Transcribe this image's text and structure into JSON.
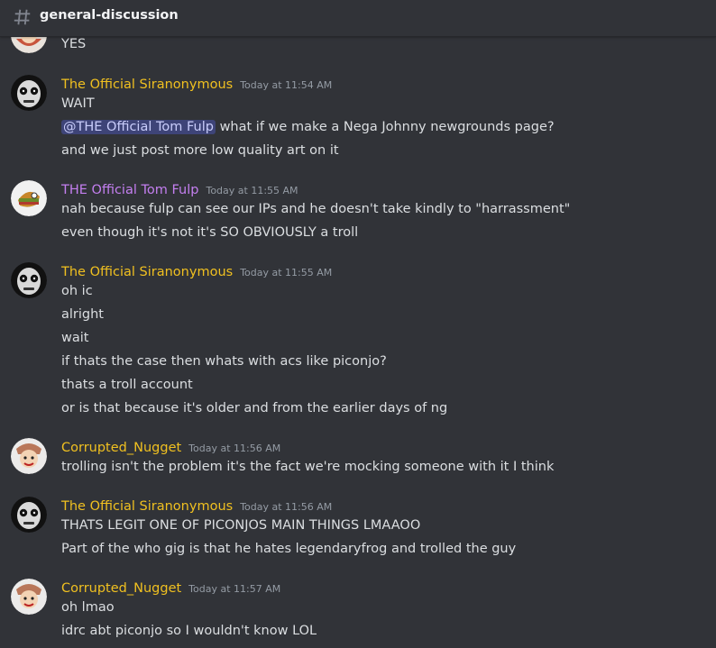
{
  "channel": {
    "icon": "hash-icon",
    "name": "general-discussion"
  },
  "colors": {
    "siranonymous": "#f0c020",
    "tom_fulp": "#c47ff0",
    "nugget": "#f0c020",
    "mention_bg": "#5865f2"
  },
  "top_partial": {
    "text": "YES"
  },
  "groups": [
    {
      "author": "The Official Siranonymous",
      "timestamp": "Today at 11:54 AM",
      "lines": [
        "WAIT",
        "what if we make a Nega Johnny newgrounds page?",
        "and we just post more low quality art on it"
      ],
      "mention": "@THE Official Tom Fulp"
    },
    {
      "author": "THE Official Tom Fulp",
      "timestamp": "Today at 11:55 AM",
      "lines": [
        "nah because fulp can see our IPs and he doesn't take kindly to \"harrassment\"",
        "even though it's not it's SO OBVIOUSLY  a troll"
      ]
    },
    {
      "author": "The Official Siranonymous",
      "timestamp": "Today at 11:55 AM",
      "lines": [
        "oh ic",
        "alright",
        "wait",
        "if thats the case then whats with acs like piconjo?",
        "thats a troll account",
        "or is that because it's older and from the earlier days of ng"
      ]
    },
    {
      "author": "Corrupted_Nugget",
      "timestamp": "Today at 11:56 AM",
      "lines": [
        "trolling isn't the problem it's the fact we're mocking someone with it I think"
      ]
    },
    {
      "author": "The Official Siranonymous",
      "timestamp": "Today at 11:56 AM",
      "lines": [
        "THATS LEGIT ONE OF PICONJOS MAIN THINGS LMAAOO",
        "Part of the who gig is that he hates legendaryfrog and trolled the guy"
      ]
    },
    {
      "author": "Corrupted_Nugget",
      "timestamp": "Today at 11:57 AM",
      "lines": [
        "oh lmao",
        "idrc abt piconjo so I wouldn't know LOL"
      ]
    }
  ]
}
